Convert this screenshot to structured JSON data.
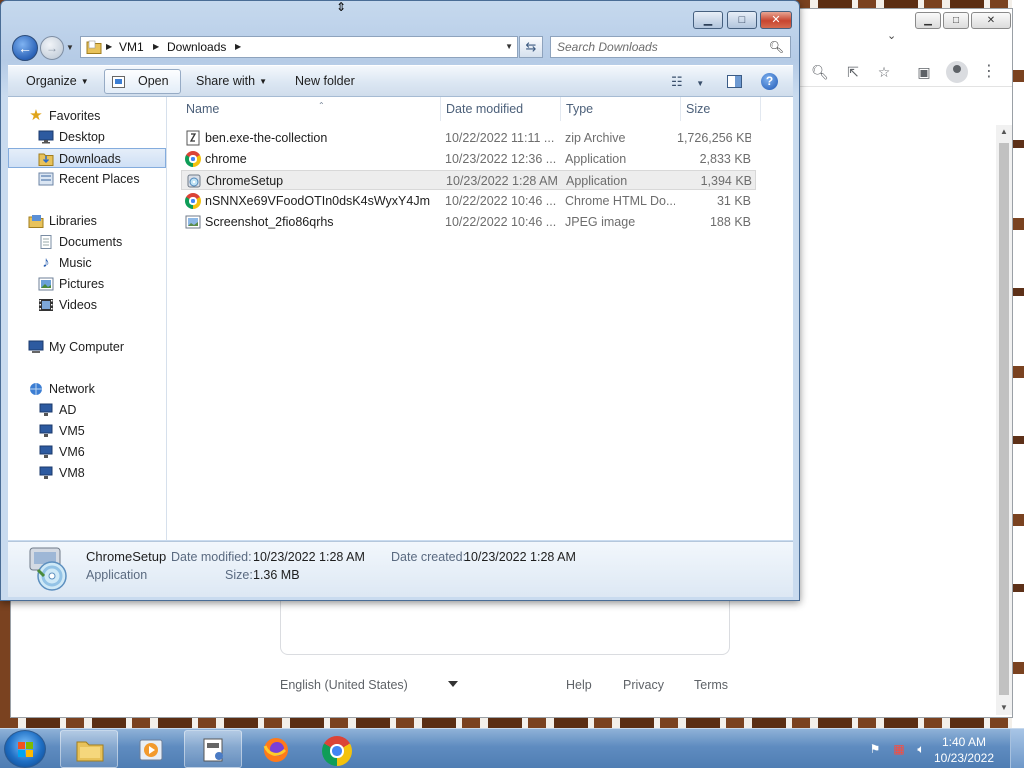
{
  "explorer": {
    "caption": {
      "minimize": "▁",
      "maximize": "□",
      "close": "✕"
    },
    "address": {
      "segments": [
        "VM1",
        "Downloads"
      ]
    },
    "search": {
      "placeholder": "Search Downloads"
    },
    "commands": {
      "organize": "Organize",
      "open": "Open",
      "share_with": "Share with",
      "new_folder": "New folder"
    },
    "nav": {
      "favorites": {
        "label": "Favorites",
        "items": [
          "Desktop",
          "Downloads",
          "Recent Places"
        ]
      },
      "libraries": {
        "label": "Libraries",
        "items": [
          "Documents",
          "Music",
          "Pictures",
          "Videos"
        ]
      },
      "my_computer": "My Computer",
      "network": {
        "label": "Network",
        "items": [
          "AD",
          "VM5",
          "VM6",
          "VM8"
        ]
      },
      "selected": "Downloads"
    },
    "columns": {
      "name": "Name",
      "date_modified": "Date modified",
      "type": "Type",
      "size": "Size"
    },
    "files": [
      {
        "name": "ben.exe-the-collection",
        "date": "10/22/2022 11:11 ...",
        "type": "zip Archive",
        "size": "1,726,256 KB",
        "icon": "zip-icon"
      },
      {
        "name": "chrome",
        "date": "10/23/2022 12:36 ...",
        "type": "Application",
        "size": "2,833 KB",
        "icon": "chrome-icon"
      },
      {
        "name": "ChromeSetup",
        "date": "10/23/2022 1:28 AM",
        "type": "Application",
        "size": "1,394 KB",
        "icon": "installer-icon"
      },
      {
        "name": "nSNNXe69VFoodOTIn0dsK4sWyxY4Jm",
        "date": "10/22/2022 10:46 ...",
        "type": "Chrome HTML Do...",
        "size": "31 KB",
        "icon": "chrome-html-icon"
      },
      {
        "name": "Screenshot_2fio86qrhs",
        "date": "10/22/2022 10:46 ...",
        "type": "JPEG image",
        "size": "188 KB",
        "icon": "image-icon"
      }
    ],
    "selected_file": "ChromeSetup",
    "details": {
      "name": "ChromeSetup",
      "type": "Application",
      "date_modified_label": "Date modified:",
      "date_modified": "10/23/2022 1:28 AM",
      "date_created_label": "Date created:",
      "date_created": "10/23/2022 1:28 AM",
      "size_label": "Size:",
      "size": "1.36 MB"
    }
  },
  "chrome_window": {
    "footer": {
      "language": "English (United States)",
      "help": "Help",
      "privacy": "Privacy",
      "terms": "Terms"
    },
    "toolbar_icons": [
      "search-icon",
      "share-icon",
      "star-icon",
      "side-panel-icon",
      "profile-icon",
      "menu-icon"
    ]
  },
  "taskbar": {
    "clock_time": "1:40 AM",
    "clock_date": "10/23/2022",
    "pinned": [
      "explorer-icon",
      "media-player-icon",
      "control-panel-icon",
      "firefox-icon",
      "chrome-icon"
    ]
  },
  "colors": {
    "accent": "#3c7ed3",
    "selection": "#cfe0f5",
    "taskbar": "#5f8cc0"
  }
}
